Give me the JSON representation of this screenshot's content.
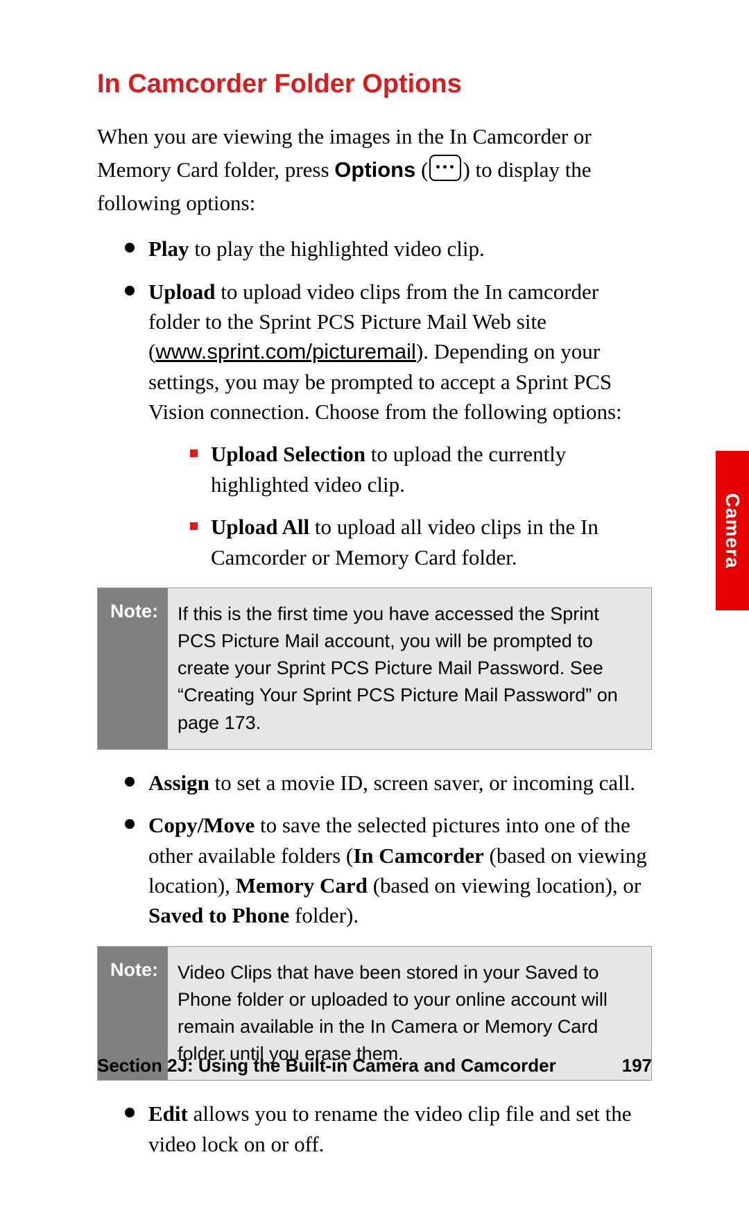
{
  "title": "In Camcorder Folder Options",
  "intro": {
    "part1": "When you are viewing the images in the In Camcorder or Memory Card folder, press ",
    "options_label": "Options",
    "part2": " (",
    "part3": ") to display the following options:"
  },
  "bullets": {
    "play": {
      "label": "Play",
      "text": " to play the highlighted video clip."
    },
    "upload": {
      "label": "Upload",
      "text_a": " to upload video clips from the  In camcorder folder to the Sprint PCS Picture Mail Web site (",
      "link": "www.sprint.com/picturemail",
      "text_b": "). Depending on your settings, you may be prompted to accept a Sprint PCS Vision connection. Choose from the following options:"
    },
    "upload_sel": {
      "label": "Upload Selection",
      "text": " to upload the currently highlighted video clip."
    },
    "upload_all": {
      "label": "Upload All",
      "text": " to upload all video clips in the In Camcorder or Memory Card folder."
    },
    "assign": {
      "label": "Assign",
      "text": " to set a movie ID, screen saver, or incoming call."
    },
    "copymove": {
      "label": "Copy/Move",
      "t1": " to save the selected pictures into one of the other available folders (",
      "b1": "In Camcorder",
      "t2": " (based on viewing location), ",
      "b2": "Memory Card",
      "t3": " (based on viewing location), or ",
      "b3": "Saved to Phone",
      "t4": " folder)."
    },
    "edit": {
      "label": "Edit",
      "text": " allows you to rename the video clip file and set the video lock on or off."
    }
  },
  "note1": {
    "label": "Note:",
    "text": "If this is the first time you have accessed the Sprint PCS Picture Mail account, you will be prompted to create your Sprint PCS Picture Mail Password. See “Creating Your Sprint PCS Picture Mail Password” on page 173."
  },
  "note2": {
    "label": "Note:",
    "text": "Video Clips that have been stored in your Saved to Phone folder or uploaded to your online account will remain available in the In Camera or Memory Card folder until you erase them."
  },
  "footer": {
    "section": "Section 2J: Using the Built-in Camera and Camcorder",
    "page": "197"
  },
  "sidetab": "Camera"
}
